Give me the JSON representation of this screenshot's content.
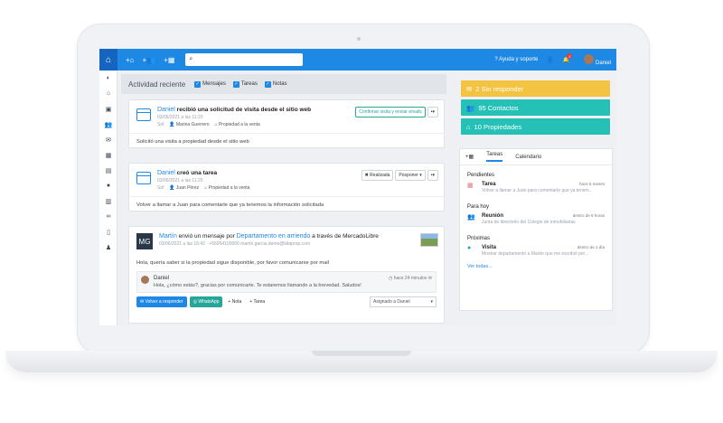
{
  "topbar": {
    "help": "Ayuda y soporte",
    "notif_count": "2",
    "user": "Daniel"
  },
  "activity": {
    "title": "Actividad reciente",
    "filters": [
      "Mensajes",
      "Tareas",
      "Notas"
    ]
  },
  "card1": {
    "who": "Daniel",
    "text": "recibió una solicitud de visita desde el sitio web",
    "date": "03/06/2021 a las 11:20",
    "label": "Sol",
    "person": "Marina Guerrero",
    "property": "Propiedad a la venta",
    "confirm": "Confirmar visita y enviar emails",
    "message": "Solicitó una visita a propiedad desde el sitio web"
  },
  "card2": {
    "who": "Daniel",
    "text": "creó una tarea",
    "date": "03/06/2021 a las 11:20",
    "label": "Sol",
    "person": "Juan Pérez",
    "property": "Propiedad a la venta",
    "done": "Realizada",
    "postpone": "Posponer",
    "message": "Volver a llamar a Juan para comentarle que ya tenemos la información solicitada"
  },
  "card3": {
    "who": "Martín",
    "text_a": "envió un mensaje por",
    "link": "Departamento en arriendo",
    "text_b": "a través de MercadoLibre",
    "meta": "03/06/2021 a las 16:42 · +56954100000 martín.garcia.demo@kitaprop.com",
    "logo": "MG",
    "message": "Hola, quería saber si la propiedad sigue disponible, por favor comunicarse por mail",
    "reply_name": "Daniel",
    "reply_time": "hace 24 minutos",
    "reply_text": "Hola, ¿cómo estás?, gracias por comunicarte. Te estaremos llamando a la brevedad. Saludos!",
    "btn_reply": "Volver a responder",
    "btn_whatsapp": "WhatsApp",
    "btn_note": "Nota",
    "btn_task": "Tarea",
    "assigned": "Asignado a Daniel"
  },
  "stats": [
    {
      "label": "2 Sin responder",
      "color": "#f5c342"
    },
    {
      "label": "95 Contactos",
      "color": "#26c1b6"
    },
    {
      "label": "10 Propiedades",
      "color": "#26c1b6"
    }
  ],
  "panel": {
    "tabs": [
      "Tareas",
      "Calendario"
    ],
    "pending_title": "Pendientes",
    "pending": {
      "title": "Tarea",
      "desc": "Volver a llamar a Juan para comentarle que ya tenem...",
      "time": "hace 5 meses"
    },
    "today_title": "Para hoy",
    "today": {
      "title": "Reunión",
      "desc": "Junta de directorio del Colegio de inmobiliarias",
      "time": "dentro de 9 horas"
    },
    "next_title": "Próximas",
    "next": {
      "title": "Visita",
      "desc": "Mostrar departamento a Martín que me escribió por...",
      "time": "dentro de 1 día"
    },
    "more": "Ver todas..."
  }
}
